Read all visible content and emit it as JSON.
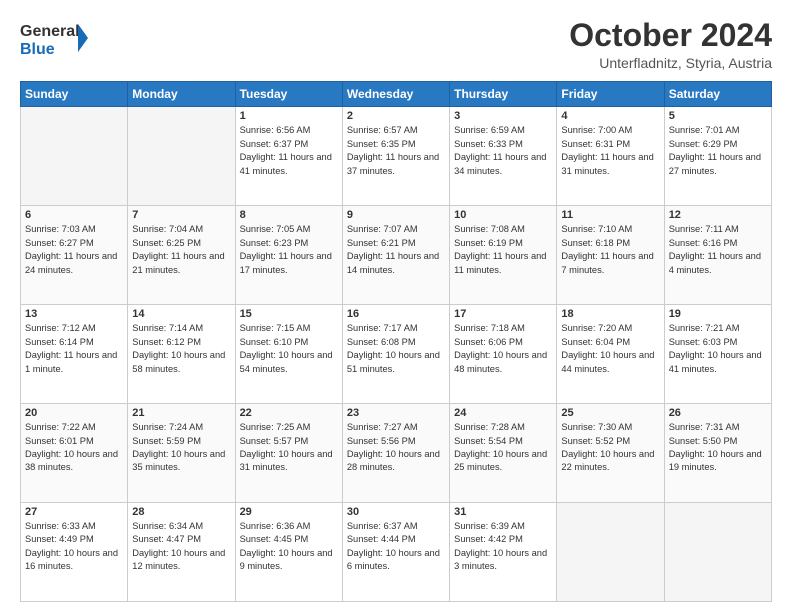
{
  "header": {
    "logo_line1": "General",
    "logo_line2": "Blue",
    "month_title": "October 2024",
    "subtitle": "Unterfladnitz, Styria, Austria"
  },
  "weekdays": [
    "Sunday",
    "Monday",
    "Tuesday",
    "Wednesday",
    "Thursday",
    "Friday",
    "Saturday"
  ],
  "weeks": [
    [
      {
        "day": "",
        "sunrise": "",
        "sunset": "",
        "daylight": "",
        "empty": true
      },
      {
        "day": "",
        "sunrise": "",
        "sunset": "",
        "daylight": "",
        "empty": true
      },
      {
        "day": "1",
        "sunrise": "Sunrise: 6:56 AM",
        "sunset": "Sunset: 6:37 PM",
        "daylight": "Daylight: 11 hours and 41 minutes.",
        "empty": false
      },
      {
        "day": "2",
        "sunrise": "Sunrise: 6:57 AM",
        "sunset": "Sunset: 6:35 PM",
        "daylight": "Daylight: 11 hours and 37 minutes.",
        "empty": false
      },
      {
        "day": "3",
        "sunrise": "Sunrise: 6:59 AM",
        "sunset": "Sunset: 6:33 PM",
        "daylight": "Daylight: 11 hours and 34 minutes.",
        "empty": false
      },
      {
        "day": "4",
        "sunrise": "Sunrise: 7:00 AM",
        "sunset": "Sunset: 6:31 PM",
        "daylight": "Daylight: 11 hours and 31 minutes.",
        "empty": false
      },
      {
        "day": "5",
        "sunrise": "Sunrise: 7:01 AM",
        "sunset": "Sunset: 6:29 PM",
        "daylight": "Daylight: 11 hours and 27 minutes.",
        "empty": false
      }
    ],
    [
      {
        "day": "6",
        "sunrise": "Sunrise: 7:03 AM",
        "sunset": "Sunset: 6:27 PM",
        "daylight": "Daylight: 11 hours and 24 minutes.",
        "empty": false
      },
      {
        "day": "7",
        "sunrise": "Sunrise: 7:04 AM",
        "sunset": "Sunset: 6:25 PM",
        "daylight": "Daylight: 11 hours and 21 minutes.",
        "empty": false
      },
      {
        "day": "8",
        "sunrise": "Sunrise: 7:05 AM",
        "sunset": "Sunset: 6:23 PM",
        "daylight": "Daylight: 11 hours and 17 minutes.",
        "empty": false
      },
      {
        "day": "9",
        "sunrise": "Sunrise: 7:07 AM",
        "sunset": "Sunset: 6:21 PM",
        "daylight": "Daylight: 11 hours and 14 minutes.",
        "empty": false
      },
      {
        "day": "10",
        "sunrise": "Sunrise: 7:08 AM",
        "sunset": "Sunset: 6:19 PM",
        "daylight": "Daylight: 11 hours and 11 minutes.",
        "empty": false
      },
      {
        "day": "11",
        "sunrise": "Sunrise: 7:10 AM",
        "sunset": "Sunset: 6:18 PM",
        "daylight": "Daylight: 11 hours and 7 minutes.",
        "empty": false
      },
      {
        "day": "12",
        "sunrise": "Sunrise: 7:11 AM",
        "sunset": "Sunset: 6:16 PM",
        "daylight": "Daylight: 11 hours and 4 minutes.",
        "empty": false
      }
    ],
    [
      {
        "day": "13",
        "sunrise": "Sunrise: 7:12 AM",
        "sunset": "Sunset: 6:14 PM",
        "daylight": "Daylight: 11 hours and 1 minute.",
        "empty": false
      },
      {
        "day": "14",
        "sunrise": "Sunrise: 7:14 AM",
        "sunset": "Sunset: 6:12 PM",
        "daylight": "Daylight: 10 hours and 58 minutes.",
        "empty": false
      },
      {
        "day": "15",
        "sunrise": "Sunrise: 7:15 AM",
        "sunset": "Sunset: 6:10 PM",
        "daylight": "Daylight: 10 hours and 54 minutes.",
        "empty": false
      },
      {
        "day": "16",
        "sunrise": "Sunrise: 7:17 AM",
        "sunset": "Sunset: 6:08 PM",
        "daylight": "Daylight: 10 hours and 51 minutes.",
        "empty": false
      },
      {
        "day": "17",
        "sunrise": "Sunrise: 7:18 AM",
        "sunset": "Sunset: 6:06 PM",
        "daylight": "Daylight: 10 hours and 48 minutes.",
        "empty": false
      },
      {
        "day": "18",
        "sunrise": "Sunrise: 7:20 AM",
        "sunset": "Sunset: 6:04 PM",
        "daylight": "Daylight: 10 hours and 44 minutes.",
        "empty": false
      },
      {
        "day": "19",
        "sunrise": "Sunrise: 7:21 AM",
        "sunset": "Sunset: 6:03 PM",
        "daylight": "Daylight: 10 hours and 41 minutes.",
        "empty": false
      }
    ],
    [
      {
        "day": "20",
        "sunrise": "Sunrise: 7:22 AM",
        "sunset": "Sunset: 6:01 PM",
        "daylight": "Daylight: 10 hours and 38 minutes.",
        "empty": false
      },
      {
        "day": "21",
        "sunrise": "Sunrise: 7:24 AM",
        "sunset": "Sunset: 5:59 PM",
        "daylight": "Daylight: 10 hours and 35 minutes.",
        "empty": false
      },
      {
        "day": "22",
        "sunrise": "Sunrise: 7:25 AM",
        "sunset": "Sunset: 5:57 PM",
        "daylight": "Daylight: 10 hours and 31 minutes.",
        "empty": false
      },
      {
        "day": "23",
        "sunrise": "Sunrise: 7:27 AM",
        "sunset": "Sunset: 5:56 PM",
        "daylight": "Daylight: 10 hours and 28 minutes.",
        "empty": false
      },
      {
        "day": "24",
        "sunrise": "Sunrise: 7:28 AM",
        "sunset": "Sunset: 5:54 PM",
        "daylight": "Daylight: 10 hours and 25 minutes.",
        "empty": false
      },
      {
        "day": "25",
        "sunrise": "Sunrise: 7:30 AM",
        "sunset": "Sunset: 5:52 PM",
        "daylight": "Daylight: 10 hours and 22 minutes.",
        "empty": false
      },
      {
        "day": "26",
        "sunrise": "Sunrise: 7:31 AM",
        "sunset": "Sunset: 5:50 PM",
        "daylight": "Daylight: 10 hours and 19 minutes.",
        "empty": false
      }
    ],
    [
      {
        "day": "27",
        "sunrise": "Sunrise: 6:33 AM",
        "sunset": "Sunset: 4:49 PM",
        "daylight": "Daylight: 10 hours and 16 minutes.",
        "empty": false
      },
      {
        "day": "28",
        "sunrise": "Sunrise: 6:34 AM",
        "sunset": "Sunset: 4:47 PM",
        "daylight": "Daylight: 10 hours and 12 minutes.",
        "empty": false
      },
      {
        "day": "29",
        "sunrise": "Sunrise: 6:36 AM",
        "sunset": "Sunset: 4:45 PM",
        "daylight": "Daylight: 10 hours and 9 minutes.",
        "empty": false
      },
      {
        "day": "30",
        "sunrise": "Sunrise: 6:37 AM",
        "sunset": "Sunset: 4:44 PM",
        "daylight": "Daylight: 10 hours and 6 minutes.",
        "empty": false
      },
      {
        "day": "31",
        "sunrise": "Sunrise: 6:39 AM",
        "sunset": "Sunset: 4:42 PM",
        "daylight": "Daylight: 10 hours and 3 minutes.",
        "empty": false
      },
      {
        "day": "",
        "sunrise": "",
        "sunset": "",
        "daylight": "",
        "empty": true
      },
      {
        "day": "",
        "sunrise": "",
        "sunset": "",
        "daylight": "",
        "empty": true
      }
    ]
  ]
}
